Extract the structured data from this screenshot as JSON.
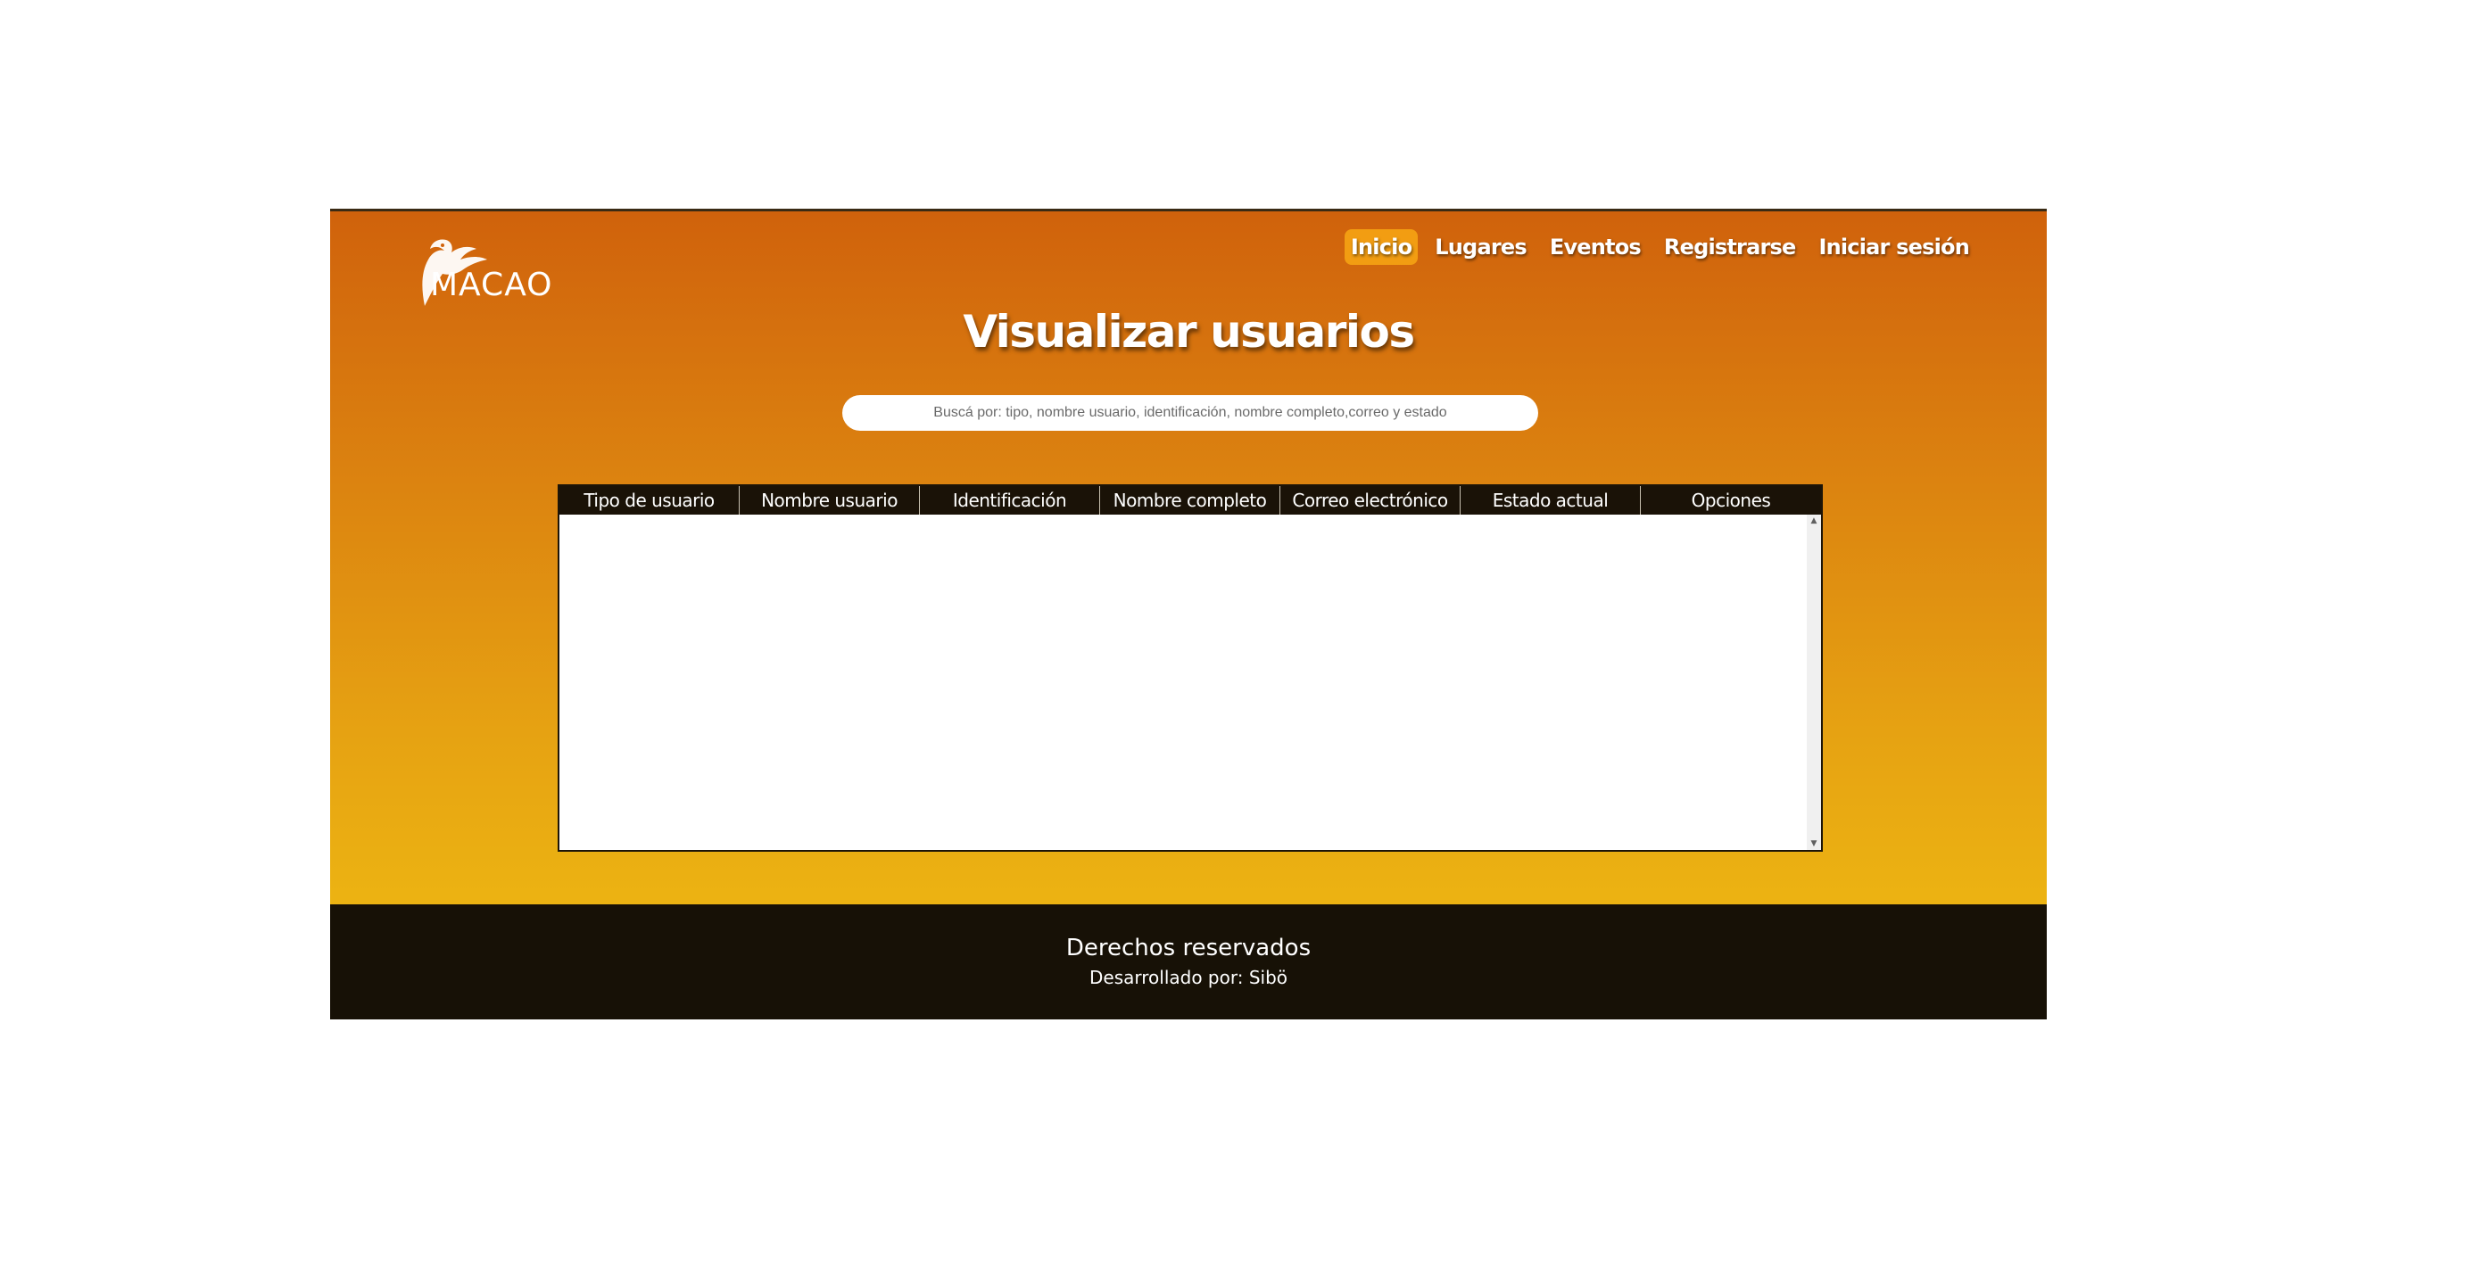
{
  "header": {
    "logo_text": "MACAO",
    "nav": [
      {
        "label": "Inicio",
        "active": true
      },
      {
        "label": "Lugares",
        "active": false
      },
      {
        "label": "Eventos",
        "active": false
      },
      {
        "label": "Registrarse",
        "active": false
      },
      {
        "label": "Iniciar sesión",
        "active": false
      }
    ]
  },
  "main": {
    "title": "Visualizar usuarios",
    "search": {
      "placeholder": "Buscá por: tipo, nombre usuario, identificación, nombre completo,correo y estado",
      "value": ""
    },
    "table": {
      "columns": [
        "Tipo de usuario",
        "Nombre usuario",
        "Identificación",
        "Nombre completo",
        "Correo electrónico",
        "Estado actual",
        "Opciones"
      ],
      "rows": []
    }
  },
  "footer": {
    "title": "Derechos reservados",
    "credit": "Desarrollado por: Sibö"
  },
  "colors": {
    "gradient_top": "#d0620c",
    "gradient_bottom": "#ecb312",
    "active_nav": "#f29d12",
    "table_header": "#1a1207",
    "footer_bg": "#171106"
  },
  "icons": {
    "logo": "macaw-parrot-icon"
  }
}
